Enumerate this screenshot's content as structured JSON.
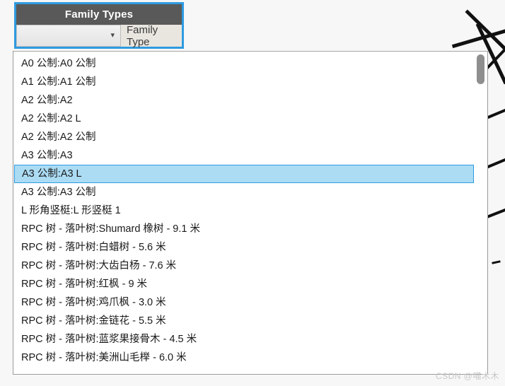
{
  "panel": {
    "title": "Family Types",
    "combo": {
      "value": "",
      "placeholder": "",
      "chevron_icon": "chevron-down-icon"
    },
    "field_label": "Family Type"
  },
  "dropdown": {
    "selected_index": 6,
    "items": [
      "A0 公制:A0 公制",
      "A1 公制:A1 公制",
      "A2 公制:A2",
      "A2 公制:A2 L",
      "A2 公制:A2 公制",
      "A3 公制:A3",
      "A3 公制:A3 L",
      "A3 公制:A3 公制",
      "L 形角竖梃:L 形竖梃 1",
      "RPC 树 - 落叶树:Shumard 橡树 - 9.1 米",
      "RPC 树 - 落叶树:白蜡树 - 5.6 米",
      "RPC 树 - 落叶树:大齿白杨 - 7.6 米",
      "RPC 树 - 落叶树:红枫 - 9 米",
      "RPC 树 - 落叶树:鸡爪枫 - 3.0 米",
      "RPC 树 - 落叶树:金链花 - 5.5 米",
      "RPC 树 - 落叶树:蓝浆果接骨木 - 4.5 米",
      "RPC 树 - 落叶树:美洲山毛榉 - 6.0 米"
    ],
    "scrollbar": {
      "thumb_position": "top"
    }
  },
  "watermark": {
    "text": "CSDN @喵木木"
  },
  "colors": {
    "accent_blue": "#2f9ae0",
    "header_gray": "#595959",
    "selection_fill": "#abdcf4",
    "page_background": "#f7f7f7"
  }
}
